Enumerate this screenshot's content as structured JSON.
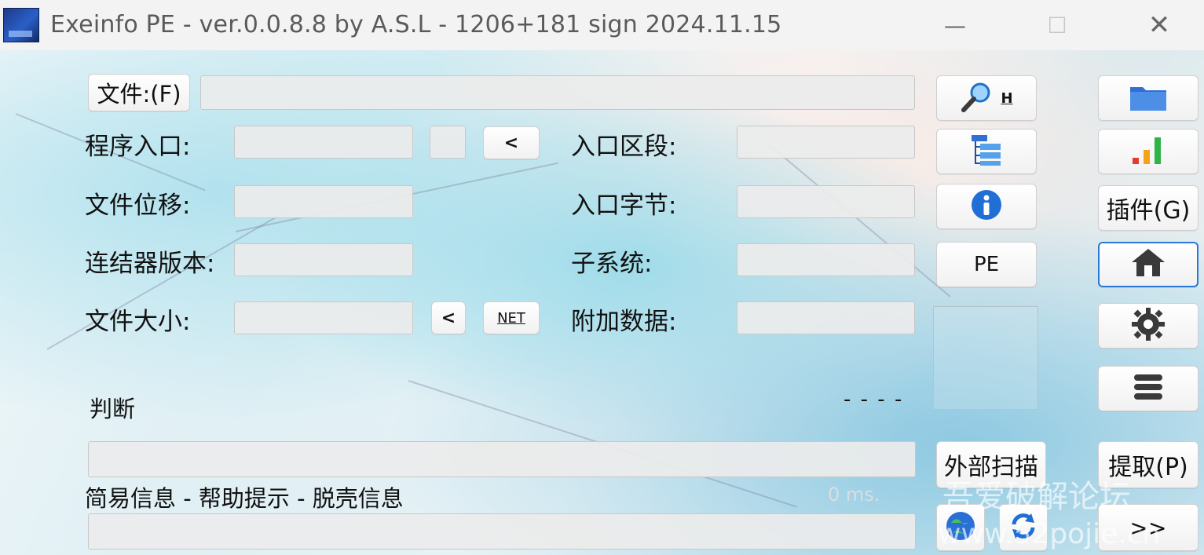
{
  "titlebar": {
    "title": "Exeinfo PE - ver.0.0.8.8  by A.S.L -  1206+181 sign  2024.11.15",
    "minimize": "—",
    "maximize": "☐",
    "close": "✕"
  },
  "file": {
    "button_label": "文件:(F)",
    "path_value": ""
  },
  "fields": {
    "entry_point": {
      "label": "程序入口:",
      "value": ""
    },
    "file_offset": {
      "label": "文件位移:",
      "value": ""
    },
    "linker_version": {
      "label": "连结器版本:",
      "value": ""
    },
    "file_size": {
      "label": "文件大小:",
      "value": ""
    },
    "entry_section": {
      "label": "入口区段:",
      "value": ""
    },
    "entry_bytes": {
      "label": "入口字节:",
      "value": ""
    },
    "subsystem": {
      "label": "子系统:",
      "value": ""
    },
    "overlay": {
      "label": "附加数据:",
      "value": ""
    }
  },
  "small_buttons": {
    "ep_back": "<",
    "size_back": "<",
    "net": "NET"
  },
  "detection": {
    "label": "判断",
    "status": "- - - -"
  },
  "info": {
    "label": "简易信息 - 帮助提示 - 脱壳信息",
    "time": "0 ms."
  },
  "right_buttons": {
    "search_hotkey": "H",
    "pe": "PE",
    "plugins": "插件(G)",
    "external_scan": "外部扫描",
    "extract": "提取(P)",
    "more": ">>"
  },
  "icons": {
    "search": "magnifier-icon",
    "tree": "tree-icon",
    "info": "info-icon",
    "folder": "folder-icon",
    "chart": "bar-chart-icon",
    "home": "home-icon",
    "settings": "gear-icon",
    "menu": "stack-icon",
    "web": "globe-icon",
    "refresh": "refresh-icon"
  },
  "watermark": {
    "line1": "吾爱破解论坛",
    "line2": "www.52pojie.cn"
  },
  "colors": {
    "accent_blue": "#1f6fd6",
    "chart_red": "#e23b2f",
    "chart_orange": "#f3a21a",
    "chart_green": "#2fb34a"
  }
}
